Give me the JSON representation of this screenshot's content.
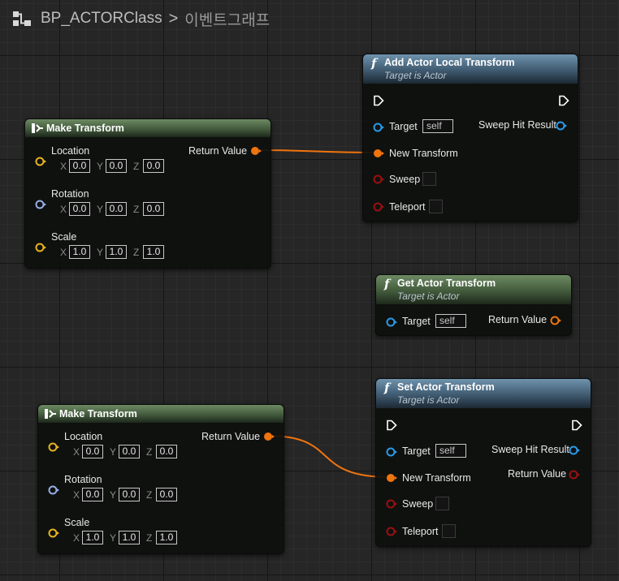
{
  "breadcrumb": {
    "class_name": "BP_ACTORClass",
    "separator": ">",
    "graph_name": "이벤트그래프"
  },
  "colors": {
    "transform_pin": "#f0740e",
    "struct_vector_pin": "#e8b320",
    "rotator_pin": "#96aee6",
    "object_pin": "#2a9ae8",
    "bool_pin": "#9a1010",
    "wire": "#f0740e"
  },
  "nodes": {
    "make_transform_1": {
      "title": "Make Transform",
      "output": "Return Value",
      "location_label": "Location",
      "rotation_label": "Rotation",
      "scale_label": "Scale",
      "axis_x": "X",
      "axis_y": "Y",
      "axis_z": "Z",
      "location": [
        "0.0",
        "0.0",
        "0.0"
      ],
      "rotation": [
        "0.0",
        "0.0",
        "0.0"
      ],
      "scale": [
        "1.0",
        "1.0",
        "1.0"
      ]
    },
    "make_transform_2": {
      "title": "Make Transform",
      "output": "Return Value",
      "location_label": "Location",
      "rotation_label": "Rotation",
      "scale_label": "Scale",
      "axis_x": "X",
      "axis_y": "Y",
      "axis_z": "Z",
      "location": [
        "0.0",
        "0.0",
        "0.0"
      ],
      "rotation": [
        "0.0",
        "0.0",
        "0.0"
      ],
      "scale": [
        "1.0",
        "1.0",
        "1.0"
      ]
    },
    "add_actor_local_transform": {
      "icon": "f",
      "title": "Add Actor Local Transform",
      "subtitle": "Target is Actor",
      "target_label": "Target",
      "target_value": "self",
      "new_transform_label": "New Transform",
      "sweep_label": "Sweep",
      "teleport_label": "Teleport",
      "sweep_hit_result_label": "Sweep Hit Result"
    },
    "get_actor_transform": {
      "icon": "f",
      "title": "Get Actor Transform",
      "subtitle": "Target is Actor",
      "target_label": "Target",
      "target_value": "self",
      "return_value_label": "Return Value"
    },
    "set_actor_transform": {
      "icon": "f",
      "title": "Set Actor Transform",
      "subtitle": "Target is Actor",
      "target_label": "Target",
      "target_value": "self",
      "new_transform_label": "New Transform",
      "sweep_label": "Sweep",
      "teleport_label": "Teleport",
      "sweep_hit_result_label": "Sweep Hit Result",
      "return_value_label": "Return Value"
    }
  }
}
